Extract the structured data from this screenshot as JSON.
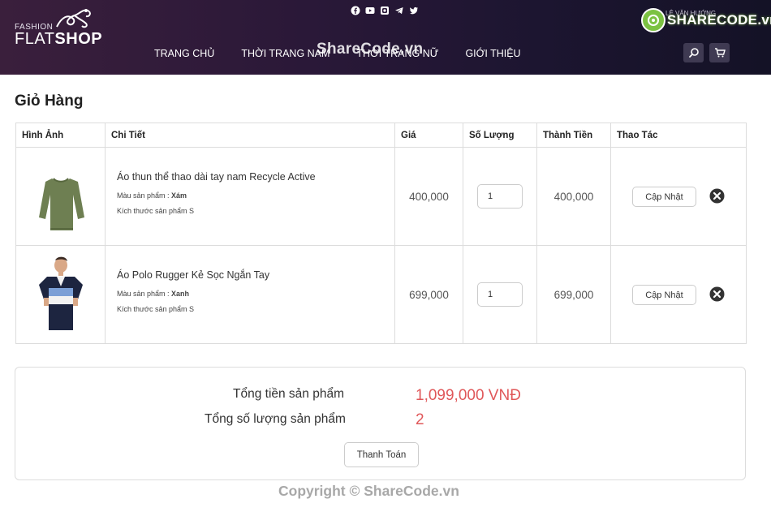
{
  "header": {
    "logo_small": "FASHION",
    "logo_flat": "FLAT",
    "logo_shop": "SHOP",
    "account_text": "LÊ VĂN HƯỚNG",
    "nav": [
      "TRANG CHỦ",
      "THỜI TRANG NAM",
      "THỜI TRANG NỮ",
      "GIỚI THIỆU"
    ],
    "social_icons": [
      "facebook-icon",
      "youtube-icon",
      "instagram-icon",
      "telegram-icon",
      "twitter-icon"
    ],
    "watermark": "ShareCode.vn",
    "badge_text": "SHARECODE.vn"
  },
  "page_title": "Giỏ Hàng",
  "table": {
    "headers": [
      "Hình Ảnh",
      "Chi Tiết",
      "Giá",
      "Số Lượng",
      "Thành Tiền",
      "Thao Tác"
    ],
    "rows": [
      {
        "name": "Áo thun thể thao dài tay nam Recycle Active",
        "color_label": "Màu sản phẩm : ",
        "color": "Xám",
        "size_label": "Kích thước sản phẩm ",
        "size": "S",
        "price": "400,000",
        "qty": "1",
        "total": "400,000",
        "update_label": "Cập Nhật"
      },
      {
        "name": "Áo Polo Rugger Kẻ Sọc Ngắn Tay",
        "color_label": "Màu sản phẩm : ",
        "color": "Xanh",
        "size_label": "Kích thước sản phẩm ",
        "size": "S",
        "price": "699,000",
        "qty": "1",
        "total": "699,000",
        "update_label": "Cập Nhật"
      }
    ]
  },
  "summary": {
    "total_label": "Tổng tiền sản phẩm",
    "total_value": "1,099,000 VNĐ",
    "count_label": "Tổng số lượng sản phẩm",
    "count_value": "2",
    "pay_label": "Thanh Toán"
  },
  "copyright": "Copyright © ShareCode.vn",
  "colors": {
    "accent_red": "#e0585a",
    "header_bg": "#2a1838",
    "badge_green": "#7cc242"
  }
}
